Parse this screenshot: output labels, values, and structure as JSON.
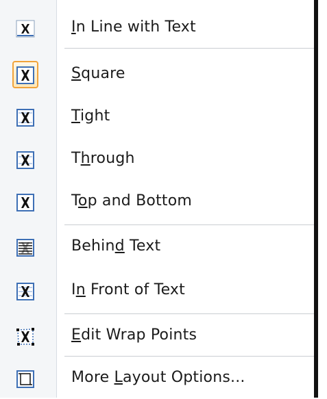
{
  "menu": {
    "items": [
      {
        "label_pre": "",
        "label_key": "I",
        "label_post": "n Line with Text",
        "icon": "inline-with-text-icon"
      },
      {
        "label_pre": "",
        "label_key": "S",
        "label_post": "quare",
        "icon": "square-wrap-icon",
        "selected": true
      },
      {
        "label_pre": "",
        "label_key": "T",
        "label_post": "ight",
        "icon": "tight-wrap-icon"
      },
      {
        "label_pre": "T",
        "label_key": "h",
        "label_post": "rough",
        "icon": "through-wrap-icon"
      },
      {
        "label_pre": "T",
        "label_key": "o",
        "label_post": "p and Bottom",
        "icon": "top-bottom-wrap-icon"
      },
      {
        "label_pre": "Behin",
        "label_key": "d",
        "label_post": " Text",
        "icon": "behind-text-icon"
      },
      {
        "label_pre": "I",
        "label_key": "n",
        "label_post": " Front of Text",
        "icon": "in-front-of-text-icon"
      },
      {
        "label_pre": "",
        "label_key": "E",
        "label_post": "dit Wrap Points",
        "icon": "edit-wrap-points-icon"
      },
      {
        "label_pre": "More ",
        "label_key": "L",
        "label_post": "ayout Options...",
        "icon": "more-layout-options-icon"
      }
    ]
  },
  "colors": {
    "selection_border": "#f0a33a",
    "icon_blue": "#3d6fb5",
    "text": "#1b1b1b"
  }
}
